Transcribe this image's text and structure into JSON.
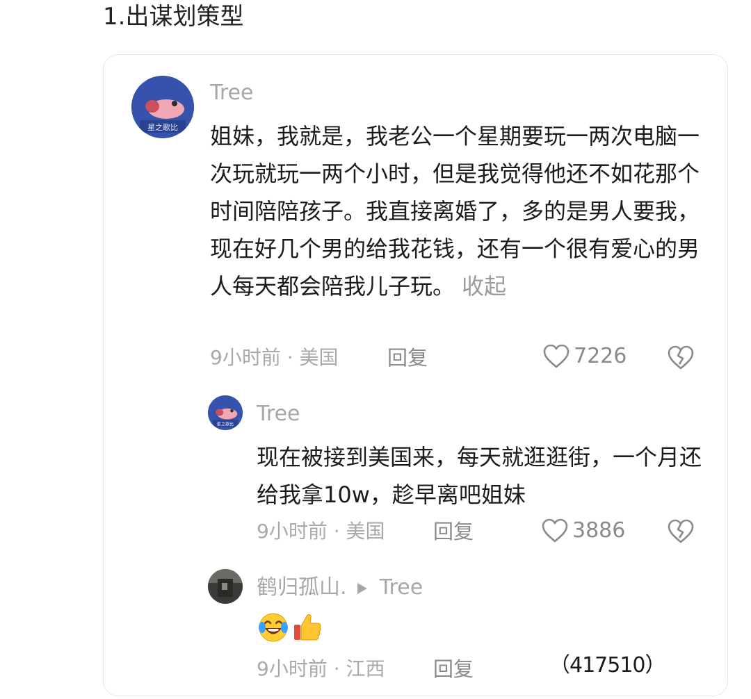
{
  "heading": "1.出谋划策型",
  "comments": [
    {
      "username": "Tree",
      "avatar_label": "星之歌比",
      "text": "姐妹，我就是，我老公一个星期要玩一两次电脑一次玩就玩一两个小时，但是我觉得他还不如花那个时间陪陪孩子。我直接离婚了，多的是男人要我，现在好几个男的给我花钱，还有一个很有爱心的男人每天都会陪我儿子玩。",
      "collapse_label": "收起",
      "meta": "9小时前 · 美国",
      "reply_label": "回复",
      "likes": "7226"
    },
    {
      "username": "Tree",
      "avatar_label": "星之歌比",
      "text": "现在被接到美国来，每天就逛逛街，一个月还给我拿10w，趁早离吧姐妹",
      "meta": "9小时前 · 美国",
      "reply_label": "回复",
      "likes": "3886"
    },
    {
      "username": "鹤归孤山.",
      "reply_to": "Tree",
      "meta": "9小时前 · 江西",
      "reply_label": "回复"
    }
  ],
  "watermark": "（417510）",
  "colors": {
    "meta_gray": "#a9a9a9",
    "text": "#1b1b1b",
    "avatar_blue": "#2f4aa0"
  },
  "icons": [
    "heart-outline-icon",
    "broken-heart-icon",
    "play-arrow-icon",
    "laughing-emoji-icon",
    "thumbs-up-emoji-icon"
  ]
}
